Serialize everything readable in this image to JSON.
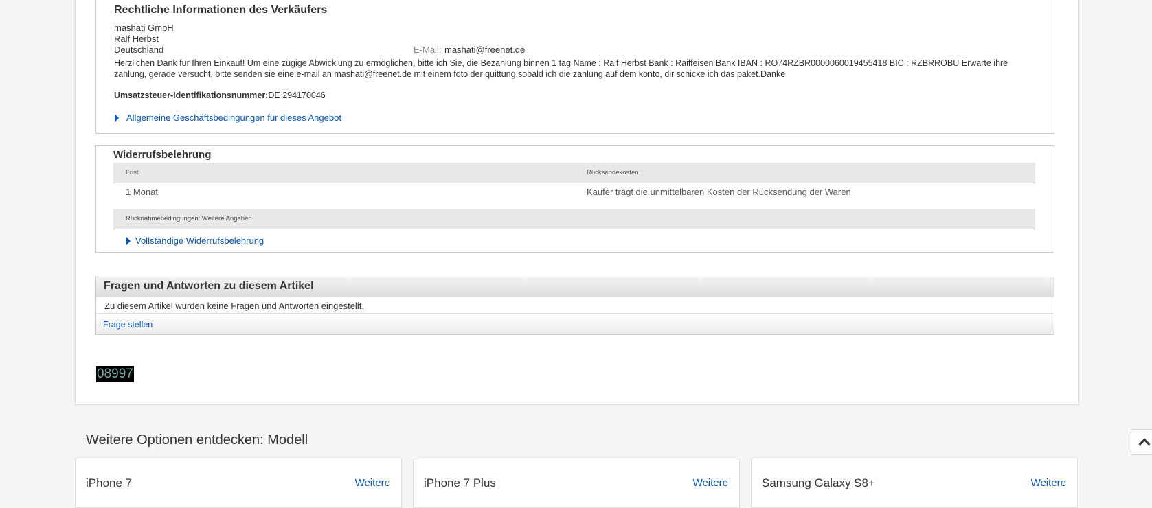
{
  "legal": {
    "title": "Rechtliche Informationen des Verkäufers",
    "company": "mashati GmbH",
    "person": "Ralf Herbst",
    "country": "Deutschland",
    "email_label": "E-Mail:",
    "email": "mashati@freenet.de",
    "message": "Herzlichen Dank für Ihren Einkauf! Um eine zügige Abwicklung zu ermöglichen, bitte ich Sie, die Bezahlung binnen 1 tag Name : Ralf Herbst Bank : Raiffeisen Bank IBAN : RO74RZBR0000060019455418 BIC : RZBRROBU Erwarte ihre zahlung, gerade versucht, bitte senden sie eine e-mail an mashati@freenet.de mit einem foto der quittung,sobald ich die zahlung auf dem konto, dir schicke ich das paket.Danke",
    "vat_label": "Umsatzsteuer-Identifikationsnummer:",
    "vat_value": "DE 294170046",
    "terms_link": "Allgemeine Geschäftsbedingungen für dieses Angebot"
  },
  "withdrawal": {
    "title": "Widerrufsbelehrung",
    "col_period": "Frist",
    "col_costs": "Rücksendekosten",
    "period_value": "1 Monat",
    "costs_value": "Käufer trägt die unmittelbaren Kosten der Rücksendung der Waren",
    "return_conditions": "Rücknahmebedingungen: Weitere Angaben",
    "full_link": "Vollständige Widerrufsbelehrung"
  },
  "qa": {
    "title": "Fragen und Antworten zu diesem Artikel",
    "empty_text": "Zu diesem Artikel wurden keine Fragen und Antworten eingestellt.",
    "ask_link": "Frage stellen"
  },
  "item_code": "08997",
  "options": {
    "title": "Weitere Optionen entdecken: Modell",
    "cards": [
      {
        "name": "iPhone 7",
        "more": "Weitere"
      },
      {
        "name": "iPhone 7 Plus",
        "more": "Weitere"
      },
      {
        "name": "Samsung Galaxy S8+",
        "more": "Weitere"
      }
    ]
  },
  "icons": {
    "link_arrow": "triangle-right-icon",
    "back_to_top": "chevron-up-icon"
  },
  "colors": {
    "link": "#0654ba",
    "code_bg": "#000000",
    "code_text": "#74a9a8"
  }
}
